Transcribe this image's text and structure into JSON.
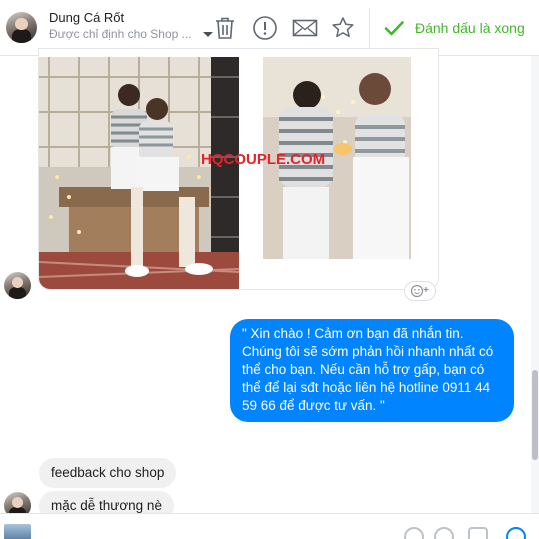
{
  "header": {
    "contact_name": "Dung Cá Rốt",
    "assign_label": "Được chỉ định cho Shop ...",
    "done_label": "Đánh dấu là xong",
    "icons": [
      "trash-icon",
      "alert-icon",
      "mail-icon",
      "star-icon",
      "check-icon"
    ]
  },
  "conversation": {
    "image_watermark": "HQCOUPLE.COM",
    "outgoing_message": "\" Xin chào ! Cảm ơn bạn đã nhắn tin. Chúng tôi sẽ sớm phản hồi nhanh nhất có thể cho bạn. Nếu cần hỗ trợ gấp, bạn có thể để lại sđt hoặc liên hệ hotline 0911 44 59 66 để được tư vấn. \"",
    "incoming_messages": [
      "feedback cho shop",
      "mặc dễ thương nè"
    ]
  },
  "colors": {
    "accent_blue": "#0084ff",
    "done_green": "#42b72a",
    "watermark_red": "#e5232a",
    "incoming_bubble": "#f1f0f0"
  }
}
